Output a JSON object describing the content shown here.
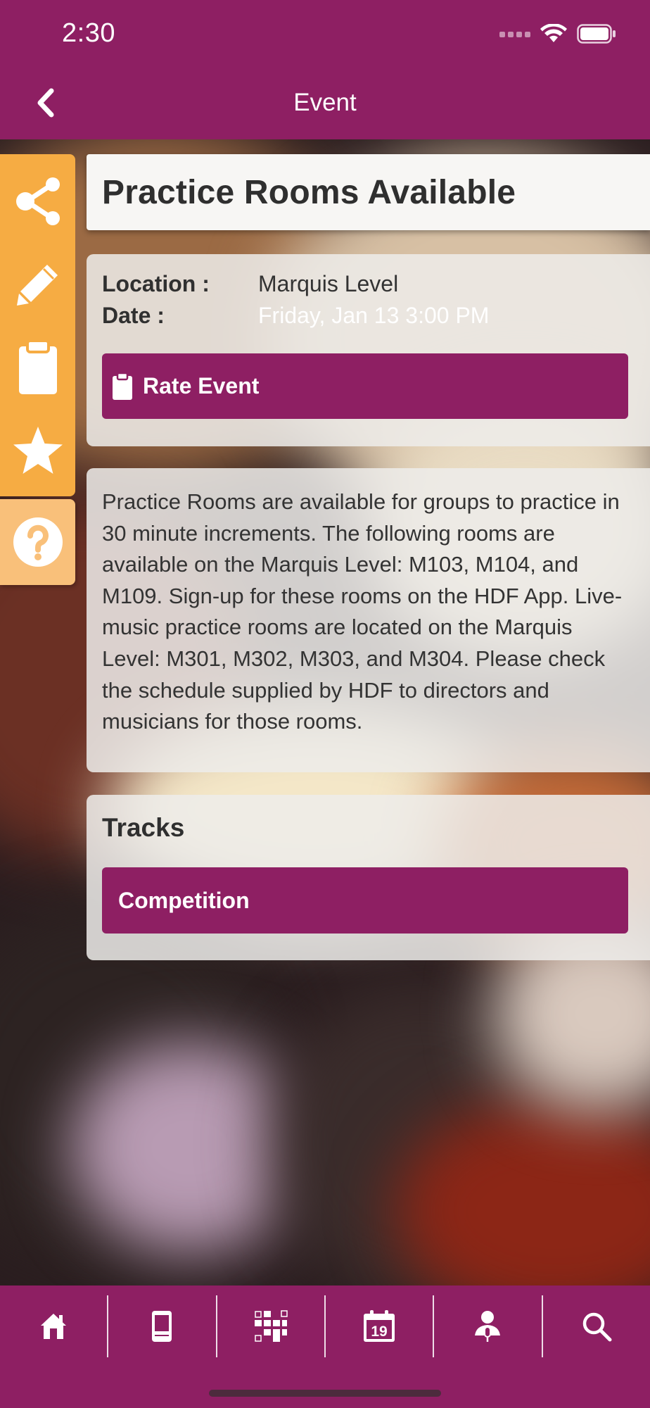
{
  "status_bar": {
    "time": "2:30"
  },
  "header": {
    "title": "Event"
  },
  "side_rail": {
    "items": [
      {
        "icon": "share-icon"
      },
      {
        "icon": "pencil-icon"
      },
      {
        "icon": "clipboard-icon"
      },
      {
        "icon": "star-icon"
      }
    ],
    "help_icon": "help-icon"
  },
  "event": {
    "title": "Practice Rooms Available",
    "location_label": "Location :",
    "location_value": "Marquis Level",
    "date_label": "Date :",
    "date_value": "Friday, Jan 13 3:00 PM",
    "rate_label": "Rate Event",
    "description": "Practice Rooms are available for groups to practice in 30 minute increments. The following rooms are available on the Marquis Level: M103, M104, and M109. Sign-up for these rooms on the HDF App. Live-music practice rooms are located on the Marquis Level: M301, M302, M303, and M304. Please check the schedule supplied by HDF to directors and musicians for those rooms.",
    "tracks_title": "Tracks",
    "tracks": [
      "Competition"
    ]
  },
  "tab_bar": {
    "tabs": [
      {
        "icon": "home-icon"
      },
      {
        "icon": "phone-icon"
      },
      {
        "icon": "grid-icon"
      },
      {
        "icon": "calendar-icon",
        "badge": "19"
      },
      {
        "icon": "speaker-icon"
      },
      {
        "icon": "search-icon"
      }
    ]
  },
  "colors": {
    "brand": "#8e1f63",
    "accent": "#f6ac43",
    "accent_light": "#f9c07a"
  }
}
